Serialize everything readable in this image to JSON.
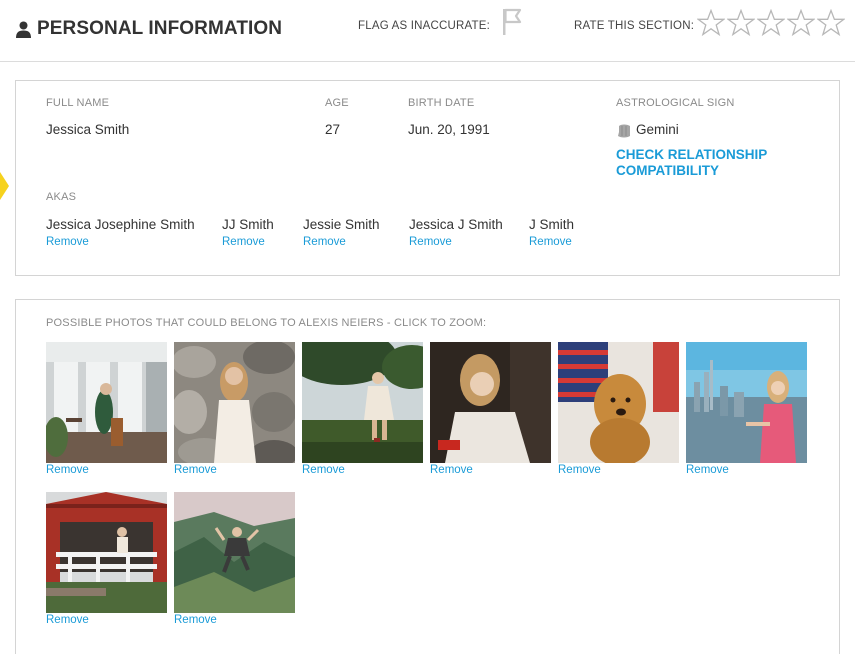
{
  "header": {
    "title": "PERSONAL INFORMATION",
    "title_icon": "user-icon",
    "flag_label": "FLAG AS INACCURATE:",
    "flag_icon": "flag-icon",
    "rate_label": "RATE THIS SECTION:",
    "stars_total": 5,
    "stars_filled": 0,
    "star_icon": "star-outline-icon"
  },
  "personal": {
    "full_name_label": "FULL NAME",
    "full_name": "Jessica Smith",
    "age_label": "AGE",
    "age": "27",
    "birth_date_label": "BIRTH DATE",
    "birth_date": "Jun. 20, 1991",
    "sign_label": "ASTROLOGICAL SIGN",
    "sign": "Gemini",
    "sign_icon": "gemini-icon",
    "compat_line1": "CHECK RELATIONSHIP",
    "compat_line2": "COMPATIBILITY",
    "akas_label": "AKAS",
    "akas": [
      {
        "name": "Jessica Josephine Smith",
        "remove": "Remove"
      },
      {
        "name": "JJ Smith",
        "remove": "Remove"
      },
      {
        "name": "Jessie Smith",
        "remove": "Remove"
      },
      {
        "name": "Jessica J Smith",
        "remove": "Remove"
      },
      {
        "name": "J Smith",
        "remove": "Remove"
      }
    ]
  },
  "photos": {
    "label": "POSSIBLE PHOTOS THAT COULD BELONG TO ALEXIS NEIERS - CLICK TO ZOOM:",
    "items": [
      {
        "remove": "Remove"
      },
      {
        "remove": "Remove"
      },
      {
        "remove": "Remove"
      },
      {
        "remove": "Remove"
      },
      {
        "remove": "Remove"
      },
      {
        "remove": "Remove"
      },
      {
        "remove": "Remove"
      },
      {
        "remove": "Remove"
      }
    ]
  },
  "colors": {
    "accent_link": "#1a9bd7",
    "label_gray": "#8a8a8a",
    "highlight_tab": "#f6d21e"
  }
}
